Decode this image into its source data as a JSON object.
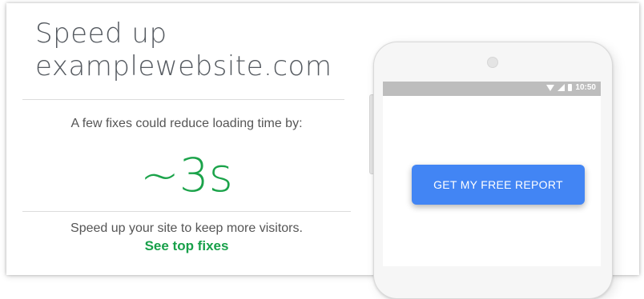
{
  "header": {
    "title_line1": "Speed up",
    "title_line2": "examplewebsite.com"
  },
  "summary": {
    "intro": "A few fixes could reduce loading time by:",
    "savings": "~3s",
    "cta_text": "Speed up your site to keep more visitors.",
    "cta_link": "See top fixes"
  },
  "phone": {
    "status_time": "10:50",
    "report_button": "GET MY FREE REPORT",
    "icons": [
      "wifi-icon",
      "signal-icon",
      "battery-icon"
    ]
  },
  "colors": {
    "accent_green": "#1ba34a",
    "button_blue": "#4285f4",
    "status_bar": "#bdbdbd"
  }
}
